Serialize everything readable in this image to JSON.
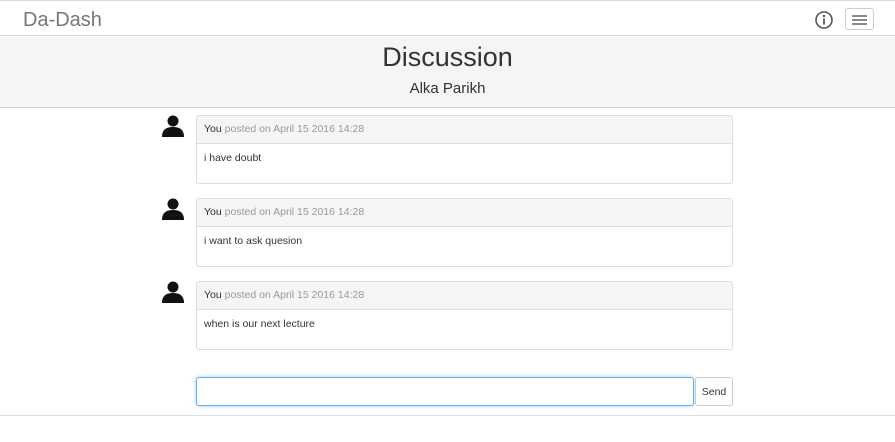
{
  "navbar": {
    "brand": "Da-Dash",
    "info_icon": "info-circle-icon",
    "menu_icon": "hamburger-menu-icon"
  },
  "header": {
    "title": "Discussion",
    "subtitle": "Alka Parikh"
  },
  "posts": [
    {
      "author": "You",
      "meta": "posted on April 15 2016 14:28",
      "text": "i have doubt",
      "avatar_icon": "user-silhouette-icon"
    },
    {
      "author": "You",
      "meta": "posted on April 15 2016 14:28",
      "text": "i want to ask quesion",
      "avatar_icon": "user-silhouette-icon"
    },
    {
      "author": "You",
      "meta": "posted on April 15 2016 14:28",
      "text": "when is our next lecture",
      "avatar_icon": "user-silhouette-icon"
    }
  ],
  "composer": {
    "value": "",
    "send_label": "Send"
  },
  "colors": {
    "focus_border": "#66afe9",
    "panel_heading": "#f3f5f7",
    "header_band": "#f5f5f5"
  }
}
